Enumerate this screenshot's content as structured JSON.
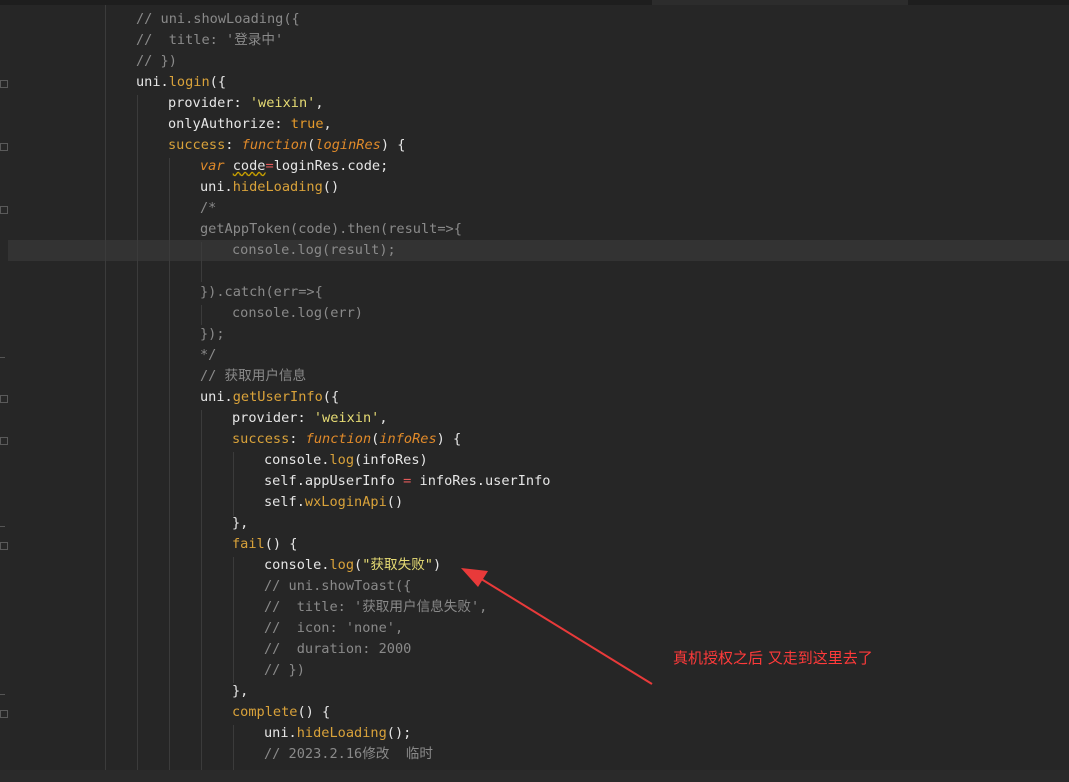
{
  "code": {
    "l1": "// uni.showLoading({",
    "l2": "//  title: '登录中'",
    "l3": "// })",
    "l4a": "uni.",
    "l4b": "login",
    "l4c": "({",
    "l5a": "provider: ",
    "l5b": "'weixin'",
    "l5c": ",",
    "l6a": "onlyAuthorize: ",
    "l6b": "true",
    "l6c": ",",
    "l7a": "success",
    "l7b": ": ",
    "l7c": "function",
    "l7d": "(",
    "l7e": "loginRes",
    "l7f": ") {",
    "l8a": "var",
    "l8b": " ",
    "l8c": "code",
    "l8d": "=",
    "l8e": "loginRes.code;",
    "l9a": "uni.",
    "l9b": "hideLoading",
    "l9c": "()",
    "l10": "/*",
    "l11": "getAppToken(code).then(result=>{",
    "l12": "console.log(result);",
    "l13": "}).catch(err=>{",
    "l14": "console.log(err)",
    "l15": "});",
    "l16": "*/",
    "l17": "// 获取用户信息",
    "l18a": "uni.",
    "l18b": "getUserInfo",
    "l18c": "({",
    "l19a": "provider: ",
    "l19b": "'weixin'",
    "l19c": ",",
    "l20a": "success",
    "l20b": ": ",
    "l20c": "function",
    "l20d": "(",
    "l20e": "infoRes",
    "l20f": ") {",
    "l21a": "console.",
    "l21b": "log",
    "l21c": "(infoRes)",
    "l22a": "self.appUserInfo ",
    "l22b": "=",
    "l22c": " infoRes.userInfo",
    "l23a": "self.",
    "l23b": "wxLoginApi",
    "l23c": "()",
    "l24": "},",
    "l25a": "fail",
    "l25b": "() {",
    "l26a": "console.",
    "l26b": "log",
    "l26c": "(",
    "l26d": "\"获取失败\"",
    "l26e": ")",
    "l27": "// uni.showToast({",
    "l28": "//  title: '获取用户信息失败',",
    "l29": "//  icon: 'none',",
    "l30": "//  duration: 2000",
    "l31": "// })",
    "l32": "},",
    "l33a": "complete",
    "l33b": "() {",
    "l34a": "uni.",
    "l34b": "hideLoading",
    "l34c": "();",
    "l35": "// 2023.2.16修改  临时"
  },
  "annotation": {
    "text": "真机授权之后 又走到这里去了",
    "color": "#ff3a3a"
  },
  "colors": {
    "background": "#262626",
    "comment": "#8a8a8a",
    "string": "#e6db74",
    "keyword": "#e08a2a",
    "arrow": "#e83a3a"
  }
}
